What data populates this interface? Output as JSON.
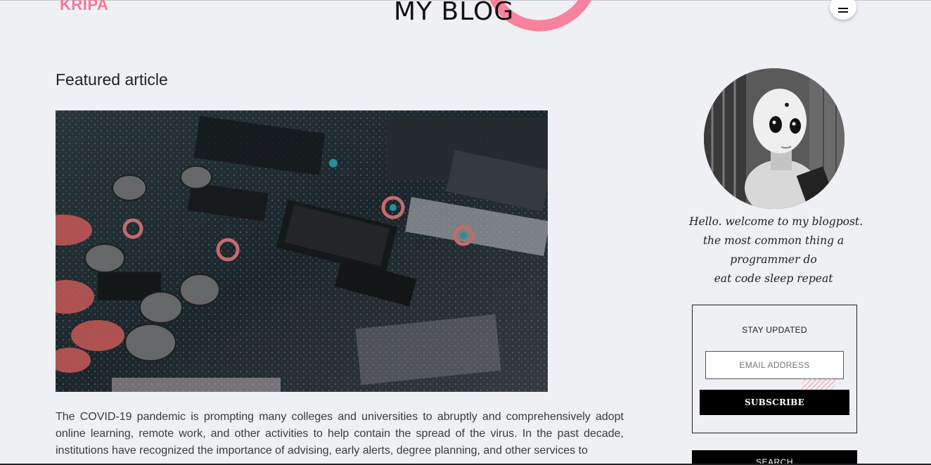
{
  "header": {
    "logo": "KRIPA",
    "site_title": "MY BLOG",
    "menu_icon": "hamburger-menu-icon"
  },
  "main": {
    "featured_heading": "Featured article",
    "featured_image_icon": "circuit-board-image",
    "article_text": "The COVID-19 pandemic is prompting many colleges and universities to abruptly and comprehensively adopt online learning, remote work, and other activities to help contain the spread of the virus. In the past decade, institutions have recognized the importance of advising, early alerts, degree planning, and other services to"
  },
  "sidebar": {
    "avatar_icon": "robot-avatar-image",
    "bio_lines": [
      "Hello. welcome to my blogpost.",
      "the most common thing a",
      "programmer do",
      "eat code sleep repeat"
    ],
    "subscribe": {
      "title": "STAY UPDATED",
      "email_placeholder": "EMAIL ADDRESS",
      "button_label": "SUBSCRIBE"
    },
    "search_label": "SEARCH"
  },
  "colors": {
    "accent_pink": "#f27a98",
    "background": "#eff0f4",
    "button_bg": "#000000"
  }
}
